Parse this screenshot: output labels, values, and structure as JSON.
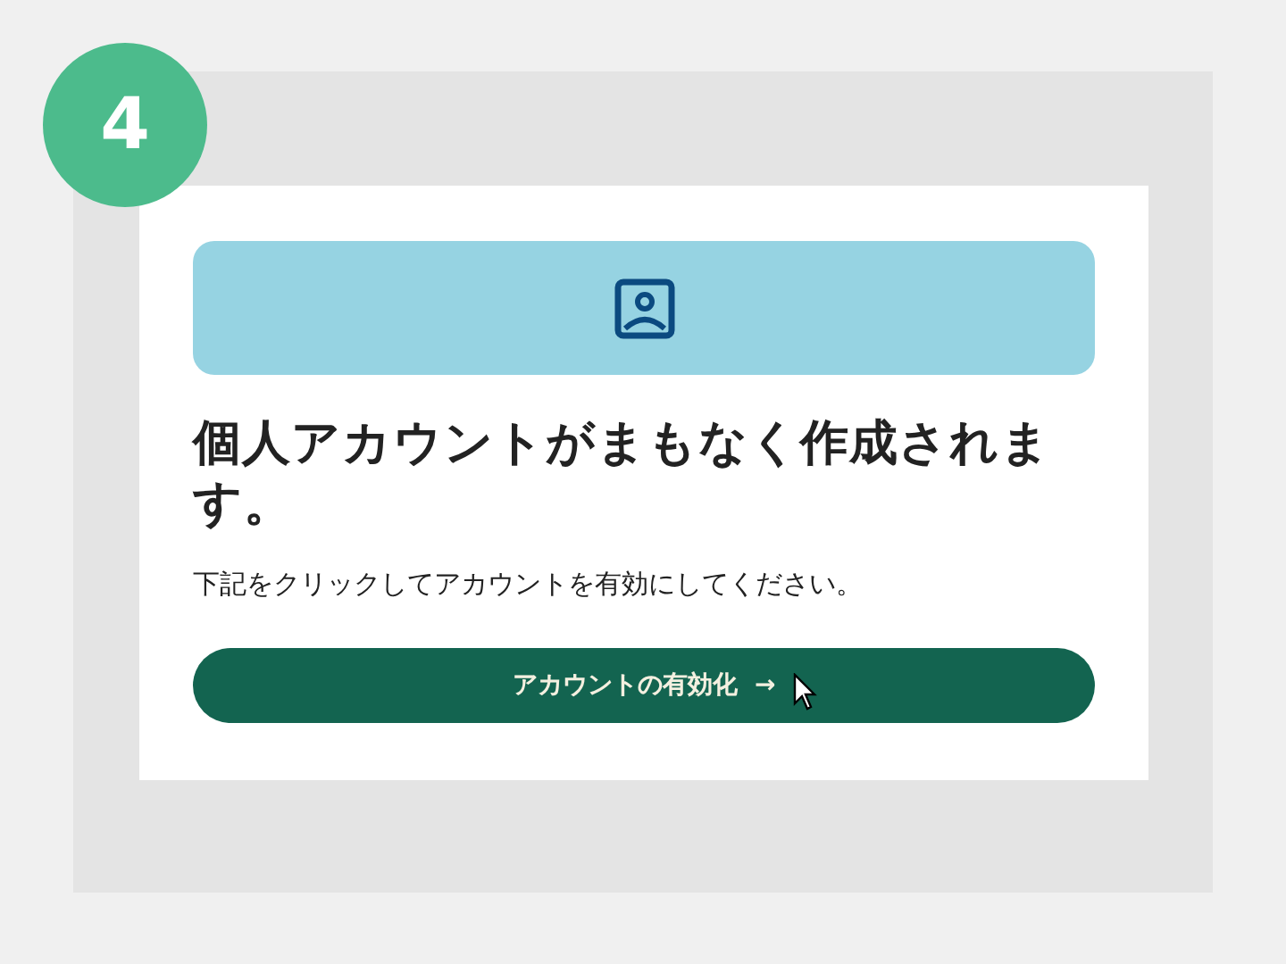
{
  "step_badge": "4",
  "card": {
    "heading": "個人アカウントがまもなく作成されます。",
    "description": "下記をクリックしてアカウントを有効にしてください。",
    "button": {
      "label": "アカウントの有効化",
      "arrow": "→"
    }
  }
}
